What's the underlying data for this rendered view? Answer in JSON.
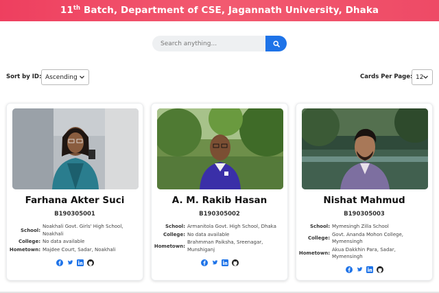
{
  "header": {
    "title_prefix": "11",
    "title_sup": "th",
    "title_rest": " Batch, Department of CSE, Jagannath University, Dhaka"
  },
  "search": {
    "placeholder": "Search anything..."
  },
  "sort": {
    "label": "Sort by ID:",
    "selected": "Ascending"
  },
  "per_page": {
    "label": "Cards Per Page:",
    "selected": "12"
  },
  "labels": {
    "school": "School:",
    "college": "College:",
    "hometown": "Hometown:"
  },
  "cards": [
    {
      "name": "Farhana Akter Suci",
      "id": "B190305001",
      "school": "Noakhali Govt. Girls' High School, Noakhali",
      "college": "No data available",
      "hometown": "Majdee Court, Sadar, Noakhali"
    },
    {
      "name": "A. M. Rakib Hasan",
      "id": "B190305002",
      "school": "Armanitola Govt. High School, Dhaka",
      "college": "No data available",
      "hometown": "Brahmman Paiksha, Sreenagar, Munshiganj"
    },
    {
      "name": "Nishat Mahmud",
      "id": "B190305003",
      "school": "Mymesingh Zilla School",
      "college": "Govt. Ananda Mohon College, Mymensingh",
      "hometown": "Akua Dakkhin Para, Sadar, Mymensingh"
    }
  ],
  "icons": {
    "search": "search-icon",
    "facebook": "facebook-icon",
    "twitter": "twitter-icon",
    "linkedin": "linkedin-icon",
    "github": "github-icon"
  },
  "colors": {
    "header": "#ee3f5f",
    "accent": "#1e73e8"
  }
}
